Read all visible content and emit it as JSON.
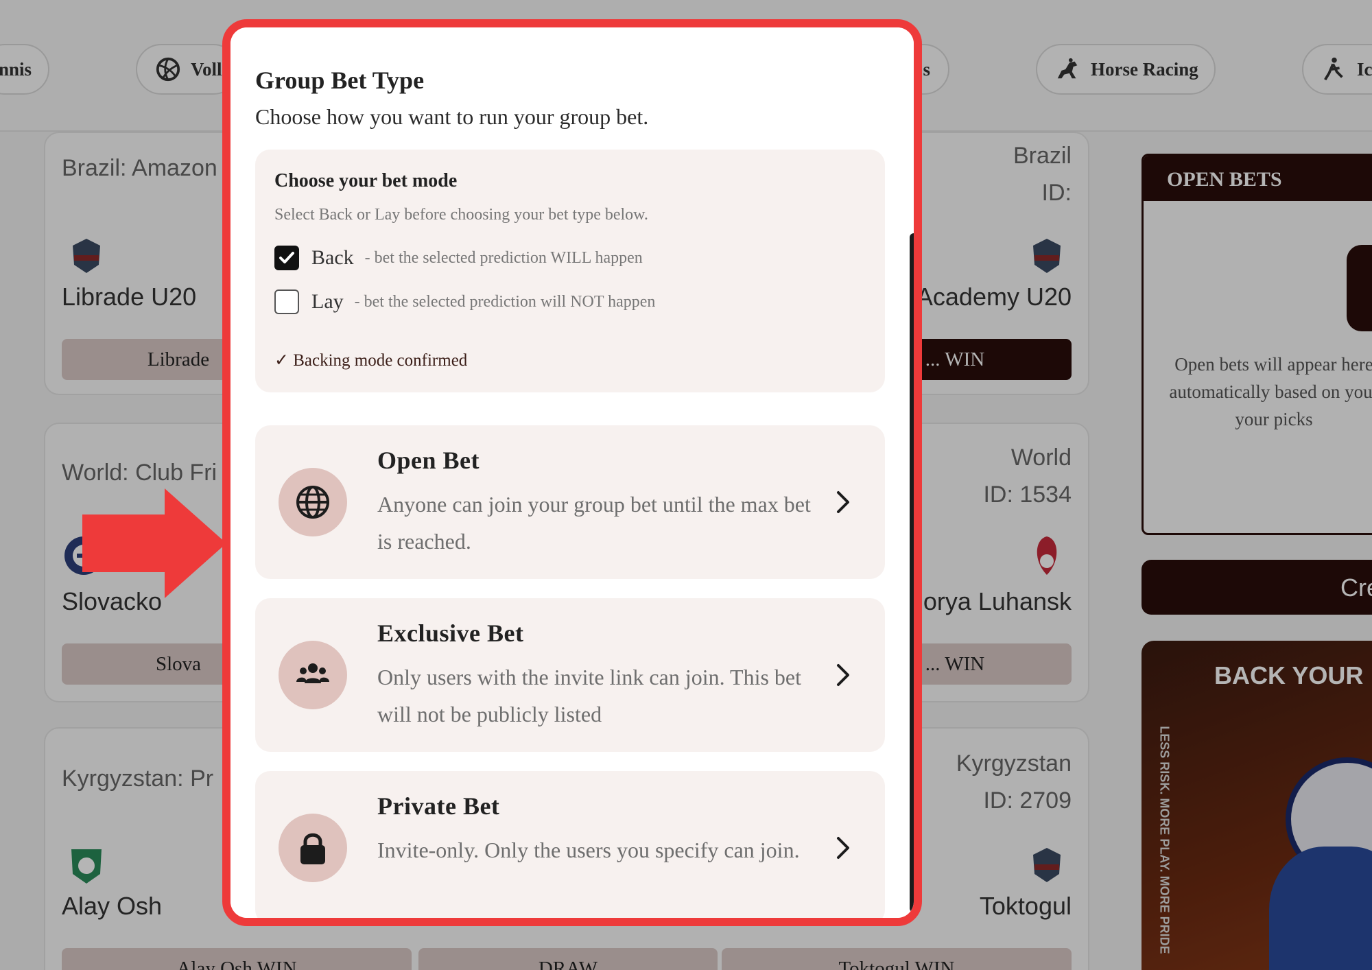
{
  "nav_pills": [
    {
      "name": "tennis",
      "label": "nnis"
    },
    {
      "name": "volleyball",
      "label": "Voll"
    },
    {
      "name": "hidden-sport",
      "label": "s"
    },
    {
      "name": "horse-racing",
      "label": "Horse Racing"
    },
    {
      "name": "ice",
      "label": "Ic"
    }
  ],
  "matches": [
    {
      "title": "Brazil: Amazon",
      "right_line1": "Brazil",
      "right_line2": "ID:",
      "home": "Librade U20",
      "away": "Academy U20",
      "odd_home": "Librade",
      "odd_away": "... WIN"
    },
    {
      "title": "World: Club Fri",
      "right_line1": "World",
      "right_line2": "ID: 1534",
      "home": "Slovacko",
      "away": "orya Luhansk",
      "odd_home": "Slova",
      "odd_away": "... WIN"
    },
    {
      "title": "Kyrgyzstan: Pr",
      "right_line1": "Kyrgyzstan",
      "right_line2": "ID: 2709",
      "home": "Alay Osh",
      "away": "Toktogul",
      "odd_home": "Alay Osh WIN",
      "odd_draw": "DRAW",
      "odd_away": "Toktogul WIN"
    }
  ],
  "sidebar": {
    "open_bets_title": "OPEN BETS",
    "open_bets_text": "Open bets will appear here automatically based on your your picks",
    "button_label": "Cre",
    "promo_title": "BACK YOUR",
    "promo_vertical": "LESS RISK. MORE PLAY. MORE PRIDE"
  },
  "modal": {
    "title": "Group Bet Type",
    "subtitle": "Choose how you want to run your group bet.",
    "mode": {
      "title": "Choose your bet mode",
      "subtitle": "Select Back or Lay before choosing your bet type below.",
      "options": [
        {
          "label": "Back",
          "desc": "- bet the selected prediction WILL happen",
          "checked": true
        },
        {
          "label": "Lay",
          "desc": "- bet the selected prediction will NOT happen",
          "checked": false
        }
      ],
      "confirmation": "✓ Backing mode confirmed"
    },
    "types": [
      {
        "icon": "globe-icon",
        "title": "Open Bet",
        "desc": "Anyone can join your group bet until the max bet is reached."
      },
      {
        "icon": "users-icon",
        "title": "Exclusive Bet",
        "desc": "Only users with the invite link can join. This bet will not be publicly listed"
      },
      {
        "icon": "lock-icon",
        "title": "Private Bet",
        "desc": "Invite-only. Only the users you specify can join."
      }
    ]
  },
  "colors": {
    "brand_dark": "#2a0e0a",
    "highlight_frame": "#ee3a3a",
    "icon_circle": "#dfc2bd",
    "card_bg": "#f7f1ef"
  }
}
